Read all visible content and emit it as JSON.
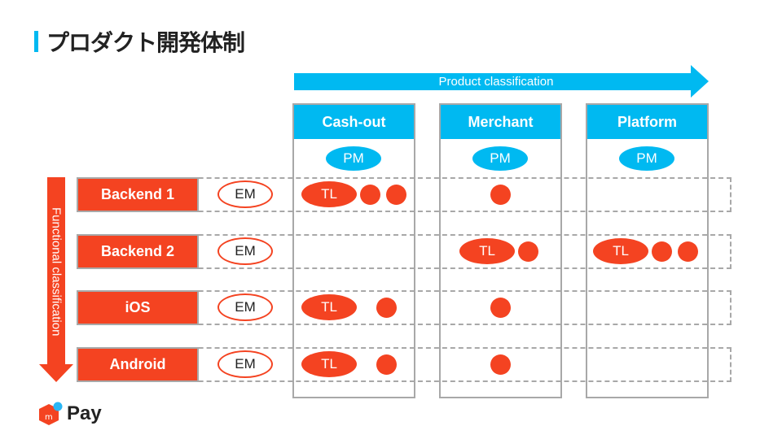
{
  "title": "プロダクト開発体制",
  "product_axis": "Product classification",
  "functional_axis": "Functional classification",
  "columns": [
    {
      "label": "Cash-out",
      "pm": "PM"
    },
    {
      "label": "Merchant",
      "pm": "PM"
    },
    {
      "label": "Platform",
      "pm": "PM"
    }
  ],
  "rows": [
    {
      "label": "Backend 1",
      "em": "EM",
      "cells": [
        {
          "tl": "TL",
          "dots": 2
        },
        {
          "tl": null,
          "dots": 1
        },
        {
          "tl": null,
          "dots": 0
        }
      ]
    },
    {
      "label": "Backend 2",
      "em": "EM",
      "cells": [
        {
          "tl": null,
          "dots": 0
        },
        {
          "tl": "TL",
          "dots": 1
        },
        {
          "tl": "TL",
          "dots": 2
        }
      ]
    },
    {
      "label": "iOS",
      "em": "EM",
      "cells": [
        {
          "tl": "TL",
          "dots": 1
        },
        {
          "tl": null,
          "dots": 1
        },
        {
          "tl": null,
          "dots": 0
        }
      ]
    },
    {
      "label": "Android",
      "em": "EM",
      "cells": [
        {
          "tl": "TL",
          "dots": 1
        },
        {
          "tl": null,
          "dots": 1
        },
        {
          "tl": null,
          "dots": 0
        }
      ]
    }
  ],
  "logo": {
    "text": "Pay",
    "mark": "m"
  },
  "colors": {
    "cyan": "#00b9f1",
    "red": "#f44321"
  }
}
